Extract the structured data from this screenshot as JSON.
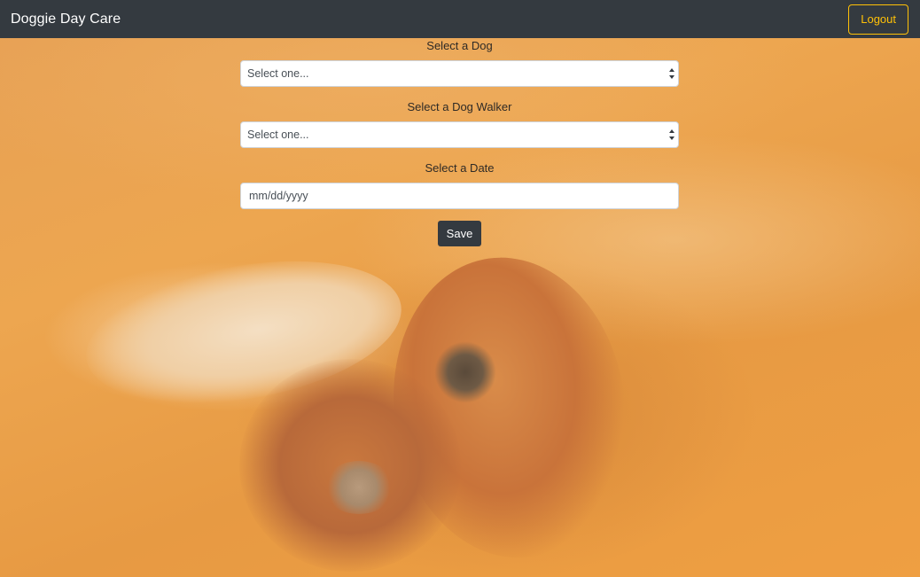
{
  "navbar": {
    "brand": "Doggie Day Care",
    "logout_label": "Logout"
  },
  "form": {
    "dog": {
      "label": "Select a Dog",
      "selected": "Select one..."
    },
    "walker": {
      "label": "Select a Dog Walker",
      "selected": "Select one..."
    },
    "date": {
      "label": "Select a Date",
      "placeholder": "mm/dd/yyyy"
    },
    "save_label": "Save"
  },
  "colors": {
    "navbar_bg": "#343a40",
    "logout_accent": "#ffc107",
    "background_tint": "#e9a24e",
    "save_bg": "#343a40"
  }
}
